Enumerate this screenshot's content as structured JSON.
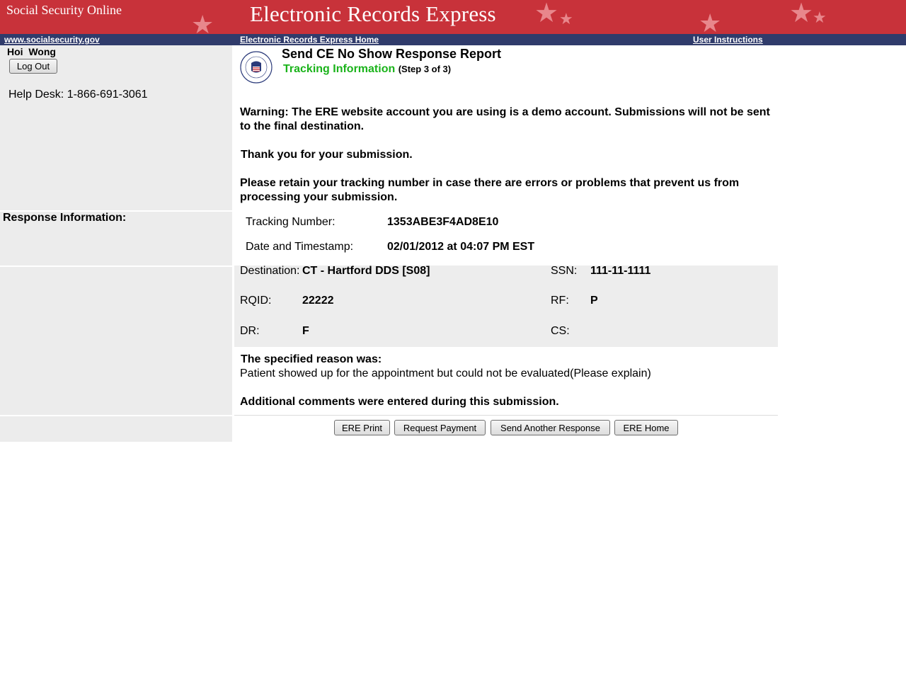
{
  "banner": {
    "site_name": "Social Security Online",
    "app_title": "Electronic Records Express"
  },
  "nav": {
    "ssa_link": "www.socialsecurity.gov",
    "home_link": "Electronic Records Express Home",
    "instructions_link": "User Instructions"
  },
  "sidebar": {
    "user_name": "Hoi  Wong",
    "logout_label": "Log Out",
    "help_desk": "Help Desk: 1-866-691-3061",
    "response_info_label": "Response Information:"
  },
  "header": {
    "title": "Send CE No Show Response Report",
    "subtitle": "Tracking Information",
    "step": "(Step 3 of 3)"
  },
  "messages": {
    "warning": "Warning: The ERE website account you are using is a demo account. Submissions will not be sent to the final destination.",
    "thanks": "Thank you for your submission.",
    "retain": "Please retain your tracking number in case there are errors or problems that prevent us from processing your submission."
  },
  "tracking": {
    "number_label": "Tracking Number:",
    "number_value": "1353ABE3F4AD8E10",
    "timestamp_label": "Date and Timestamp:",
    "timestamp_value": "02/01/2012 at 04:07 PM EST"
  },
  "details": {
    "destination_label": "Destination:",
    "destination_value": "CT - Hartford DDS [S08]",
    "ssn_label": "SSN:",
    "ssn_value": "111-11-1111",
    "rqid_label": "RQID:",
    "rqid_value": "22222",
    "rf_label": "RF:",
    "rf_value": "P",
    "dr_label": "DR:",
    "dr_value": "F",
    "cs_label": "CS:",
    "cs_value": ""
  },
  "reason": {
    "heading": "The specified reason was:",
    "text": "Patient showed up for the appointment but could not be evaluated(Please explain)",
    "additional": "Additional comments were entered during this submission."
  },
  "buttons": {
    "print": "ERE Print",
    "payment": "Request Payment",
    "another": "Send Another Response",
    "home": "ERE Home"
  },
  "colors": {
    "banner": "#c8323a",
    "navbar": "#303b6b",
    "step": "#1ab31a",
    "panel": "#ececec"
  },
  "icons": {
    "seal": "ssa-seal-icon",
    "star": "star-icon"
  }
}
